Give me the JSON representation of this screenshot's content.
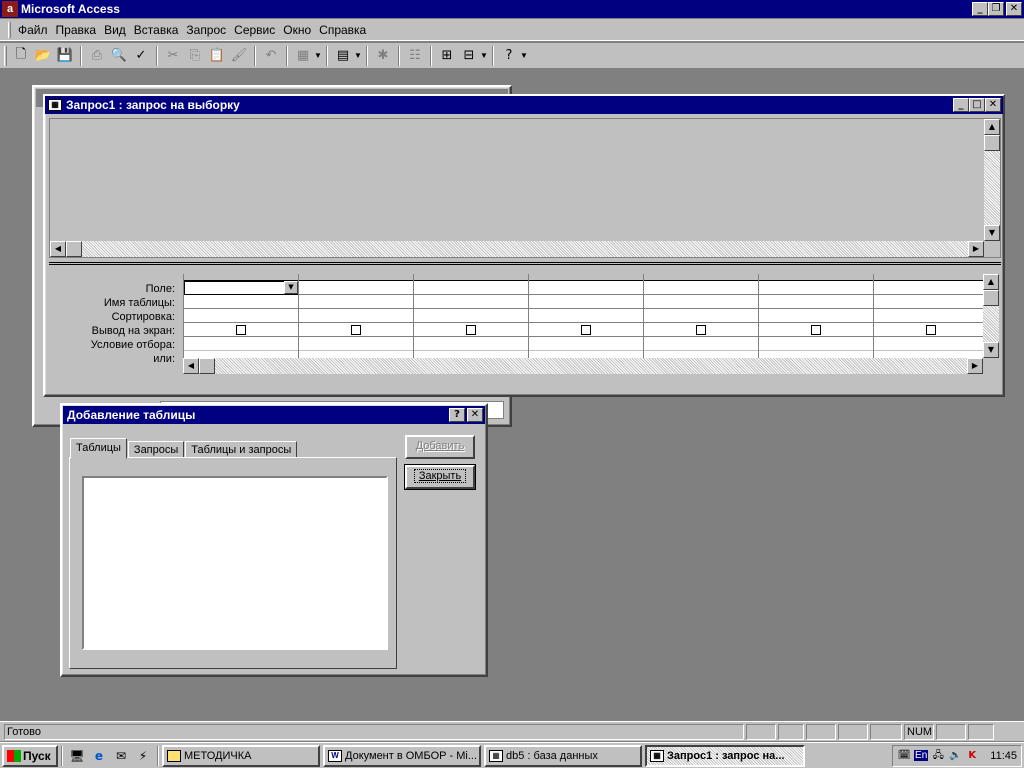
{
  "app": {
    "title": "Microsoft Access",
    "colors": {
      "title_active": "#000080",
      "face": "#c0c0c0",
      "desktop": "#808080"
    }
  },
  "menu": {
    "items": [
      {
        "label": "Файл"
      },
      {
        "label": "Правка"
      },
      {
        "label": "Вид"
      },
      {
        "label": "Вставка"
      },
      {
        "label": "Запрос"
      },
      {
        "label": "Сервис"
      },
      {
        "label": "Окно"
      },
      {
        "label": "Справка"
      }
    ]
  },
  "toolbar": {
    "icons": [
      "new-icon",
      "open-icon",
      "save-icon",
      "print-icon",
      "preview-icon",
      "spelling-icon",
      "cut-icon",
      "copy-icon",
      "paste-icon",
      "format-painter-icon",
      "undo-icon",
      "view-icon",
      "query-type-icon",
      "run-icon",
      "show-table-icon",
      "totals-icon",
      "properties-icon",
      "build-icon",
      "database-window-icon",
      "new-object-icon",
      "help-icon"
    ]
  },
  "query_window": {
    "title": "Запрос1 : запрос на выборку",
    "row_labels": [
      "Поле:",
      "Имя таблицы:",
      "Сортировка:",
      "Вывод на экран:",
      "Условие отбора:",
      "или:"
    ],
    "column_count": 7
  },
  "dialog": {
    "title": "Добавление таблицы",
    "help_label": "?",
    "tabs": [
      {
        "label": "Таблицы",
        "active": true
      },
      {
        "label": "Запросы",
        "active": false
      },
      {
        "label": "Таблицы и запросы",
        "active": false
      }
    ],
    "add_button": "Добавить",
    "close_button": "Закрыть"
  },
  "statusbar": {
    "text": "Готово",
    "num_indicator": "NUM"
  },
  "taskbar": {
    "start_label": "Пуск",
    "tasks": [
      {
        "label": "МЕТОДИЧКА",
        "icon": "folder-icon",
        "active": false
      },
      {
        "label": "Документ в ОМБОР - Mi...",
        "icon": "word-icon",
        "active": false
      },
      {
        "label": "db5 : база данных",
        "icon": "database-icon",
        "active": false
      },
      {
        "label": "Запрос1 : запрос на...",
        "icon": "query-icon",
        "active": true
      }
    ],
    "tray": {
      "language": "En",
      "clock": "11:45"
    }
  }
}
